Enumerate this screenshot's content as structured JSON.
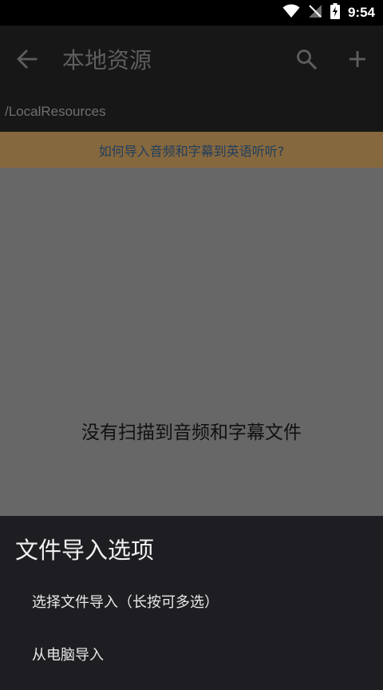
{
  "status_bar": {
    "time": "9:54",
    "icons": [
      "wifi-icon",
      "no-signal-icon",
      "battery-charging-icon"
    ]
  },
  "app_bar": {
    "title": "本地资源",
    "back_icon": "arrow-left-icon",
    "search_icon": "search-icon",
    "add_icon": "plus-icon"
  },
  "path": "/LocalResources",
  "banner": {
    "text": "如何导入音频和字幕到英语听听?"
  },
  "content": {
    "empty_message": "没有扫描到音频和字幕文件"
  },
  "sheet": {
    "title": "文件导入选项",
    "options": [
      {
        "label": "选择文件导入（长按可多选）"
      },
      {
        "label": "从电脑导入"
      }
    ]
  },
  "colors": {
    "status_bar": "#000000",
    "app_bar": "#171717",
    "banner_bg": "#86683e",
    "banner_text": "#1f3e5e",
    "content_bg": "#676767",
    "sheet_bg": "#1e1e22"
  }
}
